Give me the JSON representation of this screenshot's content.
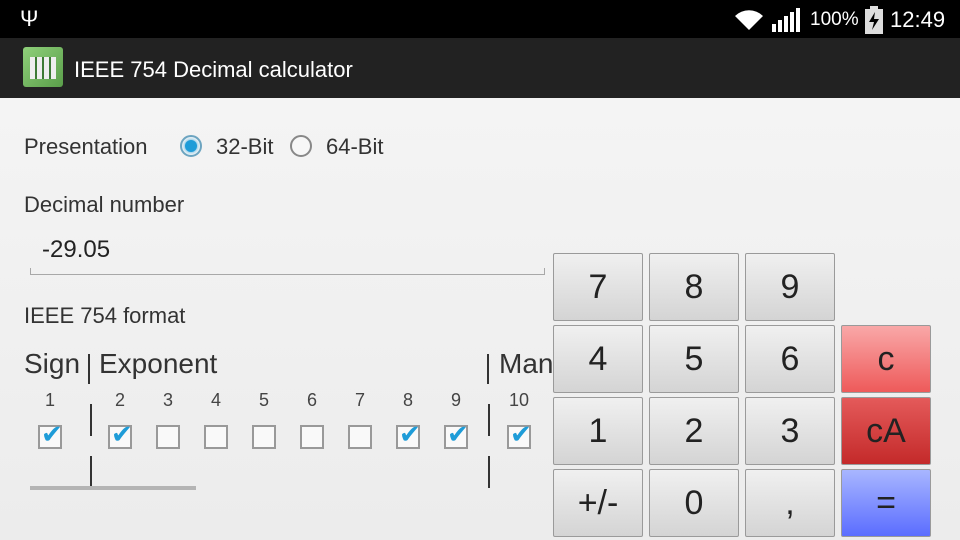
{
  "status_bar": {
    "usb_icon": "usb-icon",
    "battery": "100%",
    "time": "12:49"
  },
  "app": {
    "title": "IEEE 754 Decimal calculator"
  },
  "presentation": {
    "label": "Presentation",
    "options": [
      "32-Bit",
      "64-Bit"
    ],
    "selected": "32-Bit"
  },
  "decimal": {
    "label": "Decimal number",
    "value": "-29.05"
  },
  "ieee": {
    "label": "IEEE 754 format",
    "sign": "Sign",
    "exponent": "Exponent",
    "mantissa": "Man",
    "bits": [
      {
        "num": "1",
        "checked": true
      },
      {
        "num": "2",
        "checked": true
      },
      {
        "num": "3",
        "checked": false
      },
      {
        "num": "4",
        "checked": false
      },
      {
        "num": "5",
        "checked": false
      },
      {
        "num": "6",
        "checked": false
      },
      {
        "num": "7",
        "checked": false
      },
      {
        "num": "8",
        "checked": true
      },
      {
        "num": "9",
        "checked": true
      },
      {
        "num": "10",
        "checked": true
      }
    ]
  },
  "keypad": {
    "rows": [
      [
        "7",
        "8",
        "9"
      ],
      [
        "4",
        "5",
        "6",
        "c"
      ],
      [
        "1",
        "2",
        "3",
        "cA"
      ],
      [
        "+/-",
        "0",
        ",",
        "="
      ]
    ]
  }
}
